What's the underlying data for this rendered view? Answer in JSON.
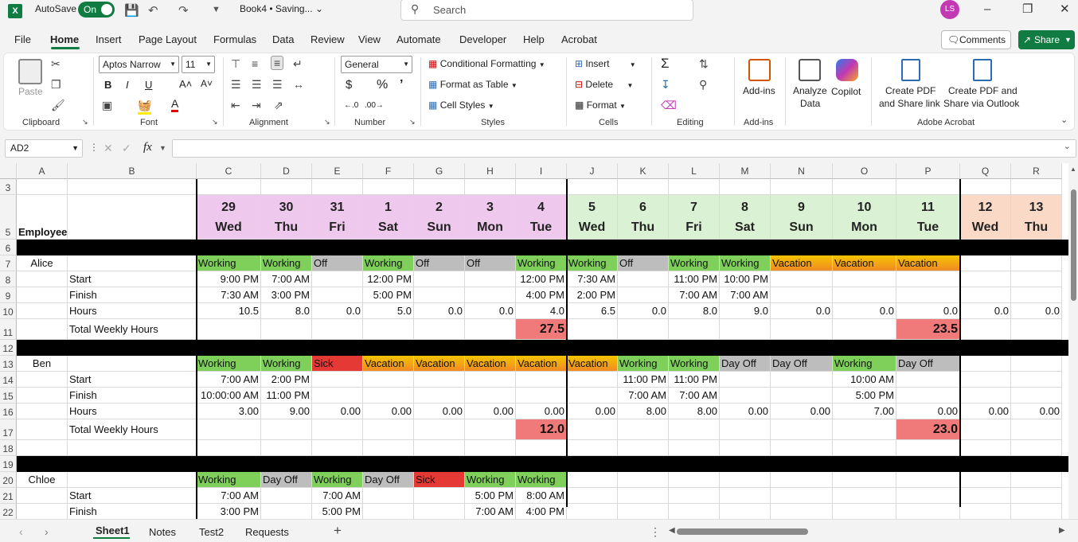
{
  "titlebar": {
    "autosave_label": "AutoSave",
    "toggle_label": "On",
    "filename": "Book4 • Saving...",
    "search_placeholder": "Search",
    "avatar": "LS",
    "chevron": "⌄"
  },
  "tabs": [
    "File",
    "Home",
    "Insert",
    "Page Layout",
    "Formulas",
    "Data",
    "Review",
    "View",
    "Automate",
    "Developer",
    "Help",
    "Acrobat"
  ],
  "actions": {
    "comments": "Comments",
    "share": "Share"
  },
  "ribbon": {
    "clipboard": {
      "label": "Clipboard",
      "paste": "Paste"
    },
    "font": {
      "label": "Font",
      "name": "Aptos Narrow",
      "size": "11",
      "bold": "B",
      "italic": "I",
      "underline": "U",
      "grow": "A˄",
      "shrink": "A˅",
      "fontcolor": "A"
    },
    "alignment": {
      "label": "Alignment"
    },
    "number": {
      "label": "Number",
      "format": "General",
      "currency": "$",
      "percent": "%",
      "comma": "’",
      "inc": "←.0",
      "dec": ".00→"
    },
    "styles": {
      "label": "Styles",
      "conditional": "Conditional Formatting",
      "table": "Format as Table",
      "cellstyles": "Cell Styles"
    },
    "cells": {
      "label": "Cells",
      "insert": "Insert",
      "delete": "Delete",
      "format": "Format"
    },
    "editing": {
      "label": "Editing",
      "sum": "Σ"
    },
    "addins": {
      "label": "Add-ins",
      "btn": "Add-ins"
    },
    "analyze": {
      "btn1": "Analyze",
      "btn2": "Data",
      "copilot": "Copilot"
    },
    "acrobat": {
      "label": "Adobe Acrobat",
      "pdf1a": "Create PDF",
      "pdf1b": "and Share link",
      "pdf2a": "Create PDF and",
      "pdf2b": "Share via Outlook"
    }
  },
  "formulabar": {
    "namebox": "AD2",
    "cancel": "✕",
    "enter": "✓",
    "fx": "fx",
    "value": ""
  },
  "columns": [
    "A",
    "B",
    "C",
    "D",
    "E",
    "F",
    "G",
    "H",
    "I",
    "J",
    "K",
    "L",
    "M",
    "N",
    "O",
    "P",
    "Q",
    "R"
  ],
  "rows": [
    "3",
    "5",
    "6",
    "7",
    "8",
    "9",
    "10",
    "11",
    "12",
    "13",
    "14",
    "15",
    "16",
    "17",
    "18",
    "19",
    "20",
    "21",
    "22"
  ],
  "header": {
    "employee": "Employee",
    "days": [
      {
        "d": "29",
        "w": "Wed"
      },
      {
        "d": "30",
        "w": "Thu"
      },
      {
        "d": "31",
        "w": "Fri"
      },
      {
        "d": "1",
        "w": "Sat"
      },
      {
        "d": "2",
        "w": "Sun"
      },
      {
        "d": "3",
        "w": "Mon"
      },
      {
        "d": "4",
        "w": "Tue"
      },
      {
        "d": "5",
        "w": "Wed"
      },
      {
        "d": "6",
        "w": "Thu"
      },
      {
        "d": "7",
        "w": "Fri"
      },
      {
        "d": "8",
        "w": "Sat"
      },
      {
        "d": "9",
        "w": "Sun"
      },
      {
        "d": "10",
        "w": "Mon"
      },
      {
        "d": "11",
        "w": "Tue"
      },
      {
        "d": "12",
        "w": "Wed"
      },
      {
        "d": "13",
        "w": "Thu"
      }
    ]
  },
  "colors": {
    "excel_green": "#107c41",
    "working": "#7fd05b",
    "off": "#bdbdbd",
    "sick": "#e53935",
    "vacation": "#f5a623",
    "total": "#f07a7a",
    "week1": "#efc8ee",
    "week2": "#daf1d3",
    "week3": "#fbd9c7"
  },
  "labels": {
    "start": "Start",
    "finish": "Finish",
    "hours": "Hours",
    "total": "Total Weekly Hours"
  },
  "employees": [
    {
      "name": "Alice",
      "status": [
        "Working",
        "Working",
        "Off",
        "Working",
        "Off",
        "Off",
        "Working",
        "Working",
        "Off",
        "Working",
        "Working",
        "Vacation",
        "Vacation",
        "Vacation",
        "",
        ""
      ],
      "start": [
        "9:00 PM",
        "7:00 AM",
        "",
        "12:00 PM",
        "",
        "",
        "12:00 PM",
        "7:30 AM",
        "",
        "11:00 PM",
        "10:00 PM",
        "",
        "",
        "",
        "",
        ""
      ],
      "finish": [
        "7:30 AM",
        "3:00 PM",
        "",
        "5:00 PM",
        "",
        "",
        "4:00 PM",
        "2:00 PM",
        "",
        "7:00 AM",
        "7:00 AM",
        "",
        "",
        "",
        "",
        ""
      ],
      "hours": [
        "10.5",
        "8.0",
        "0.0",
        "5.0",
        "0.0",
        "0.0",
        "4.0",
        "6.5",
        "0.0",
        "8.0",
        "9.0",
        "0.0",
        "0.0",
        "0.0",
        "0.0",
        "0.0"
      ],
      "totals": [
        "27.5",
        "23.5"
      ]
    },
    {
      "name": "Ben",
      "status": [
        "Working",
        "Working",
        "Sick",
        "Vacation",
        "Vacation",
        "Vacation",
        "Vacation",
        "Vacation",
        "Working",
        "Working",
        "Day Off",
        "Day Off",
        "Working",
        "Day Off",
        "",
        ""
      ],
      "start": [
        "7:00 AM",
        "2:00 PM",
        "",
        "",
        "",
        "",
        "",
        "",
        "11:00 PM",
        "11:00 PM",
        "",
        "",
        "10:00 AM",
        "",
        "",
        ""
      ],
      "finish": [
        "10:00:00 AM",
        "11:00 PM",
        "",
        "",
        "",
        "",
        "",
        "",
        "7:00 AM",
        "7:00 AM",
        "",
        "",
        "5:00 PM",
        "",
        "",
        ""
      ],
      "hours": [
        "3.00",
        "9.00",
        "0.00",
        "0.00",
        "0.00",
        "0.00",
        "0.00",
        "0.00",
        "8.00",
        "8.00",
        "0.00",
        "0.00",
        "7.00",
        "0.00",
        "0.00",
        "0.00"
      ],
      "totals": [
        "12.0",
        "23.0"
      ]
    },
    {
      "name": "Chloe",
      "status": [
        "Working",
        "Day Off",
        "Working",
        "Day Off",
        "Sick",
        "Working",
        "Working",
        "",
        "",
        "",
        "",
        "",
        "",
        "",
        "",
        ""
      ],
      "start": [
        "7:00 AM",
        "",
        "7:00 AM",
        "",
        "",
        "5:00 PM",
        "8:00 AM",
        "",
        "",
        "",
        "",
        "",
        "",
        "",
        "",
        ""
      ],
      "finish": [
        "3:00 PM",
        "",
        "5:00 PM",
        "",
        "",
        "7:00 AM",
        "4:00 PM",
        "",
        "",
        "",
        "",
        "",
        "",
        "",
        "",
        ""
      ]
    }
  ],
  "sheets": [
    "Sheet1",
    "Notes",
    "Test2",
    "Requests"
  ],
  "sheetbar": {
    "add": "+",
    "more": "⋮"
  }
}
